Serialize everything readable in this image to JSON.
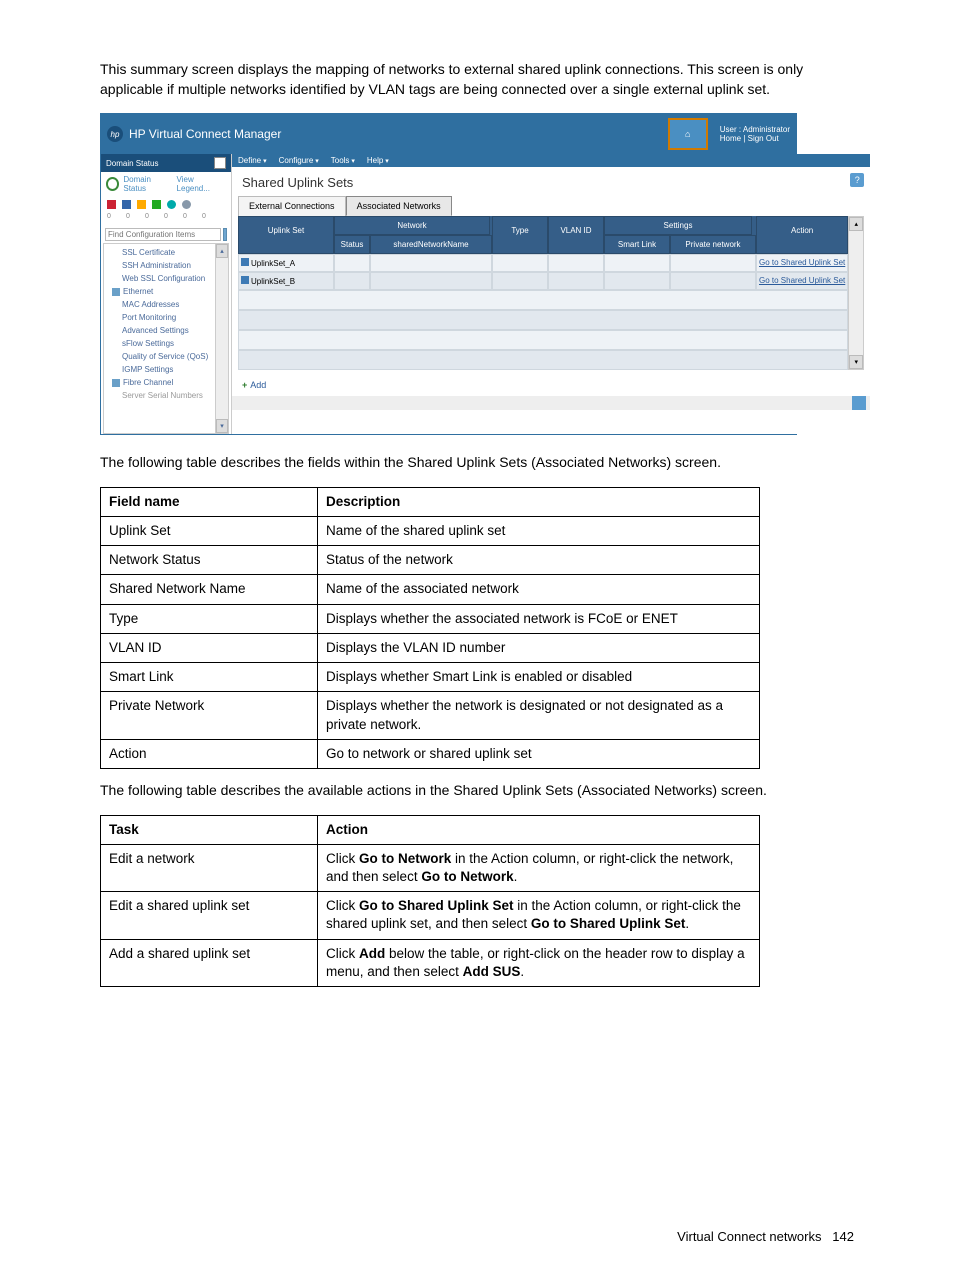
{
  "intro_paragraph": "This summary screen displays the mapping of networks to external shared uplink connections. This screen is only applicable if multiple networks identified by VLAN tags are being connected over a single external uplink set.",
  "table1_intro": "The following table describes the fields within the Shared Uplink Sets (Associated Networks) screen.",
  "table2_intro": "The following table describes the available actions in the Shared Uplink Sets (Associated Networks) screen.",
  "footer": {
    "section": "Virtual Connect networks",
    "page": "142"
  },
  "app": {
    "title": "HP Virtual Connect Manager",
    "user_line1": "User : Administrator",
    "user_line2": "Home  |  Sign Out",
    "menus": {
      "define": "Define",
      "configure": "Configure",
      "tools": "Tools",
      "help": "Help"
    },
    "domain_status_label": "Domain Status",
    "domain_status_link": "Domain Status",
    "view_legend": "View Legend...",
    "search_placeholder": "Find Configuration Items",
    "nav": {
      "ssl_cert": "SSL Certificate",
      "ssh_admin": "SSH Administration",
      "web_ssl": "Web SSL Configuration",
      "ethernet": "Ethernet",
      "mac": "MAC Addresses",
      "port_mon": "Port Monitoring",
      "adv": "Advanced Settings",
      "sflow": "sFlow Settings",
      "qos": "Quality of Service (QoS)",
      "igmp": "IGMP Settings",
      "fc": "Fibre Channel",
      "serial": "Server Serial Numbers"
    },
    "panel_title": "Shared Uplink Sets",
    "tabs": {
      "ext": "External Connections",
      "assoc": "Associated Networks"
    },
    "grid": {
      "h_uplink": "Uplink Set",
      "h_network_group": "Network",
      "h_status": "Status",
      "h_snn": "sharedNetworkName",
      "h_type": "Type",
      "h_vlan": "VLAN ID",
      "h_settings_group": "Settings",
      "h_smartlink": "Smart Link",
      "h_private": "Private network",
      "h_action": "Action",
      "row_a": "UplinkSet_A",
      "row_b": "UplinkSet_B",
      "action_link": "Go to Shared Uplink Set"
    },
    "add_label": "Add"
  },
  "fields_table": {
    "h1": "Field name",
    "h2": "Description",
    "rows": [
      {
        "name": "Uplink Set",
        "desc": "Name of the shared uplink set"
      },
      {
        "name": "Network Status",
        "desc": "Status of the network"
      },
      {
        "name": "Shared Network Name",
        "desc": "Name of the associated network"
      },
      {
        "name": "Type",
        "desc": "Displays whether the associated network is FCoE or ENET"
      },
      {
        "name": "VLAN ID",
        "desc": "Displays the VLAN ID number"
      },
      {
        "name": "Smart Link",
        "desc": "Displays whether Smart Link is enabled or disabled"
      },
      {
        "name": "Private Network",
        "desc": "Displays whether the network is designated or not designated as a private network."
      },
      {
        "name": "Action",
        "desc": "Go to network or shared uplink set"
      }
    ]
  },
  "actions_table": {
    "h1": "Task",
    "h2": "Action",
    "rows": [
      {
        "task": "Edit a network",
        "pre": "Click ",
        "b1": "Go to Network",
        "mid": " in the Action column, or right-click the network, and then select ",
        "b2": "Go to Network",
        "post": "."
      },
      {
        "task": "Edit a shared uplink set",
        "pre": "Click ",
        "b1": "Go to Shared Uplink Set",
        "mid": " in the Action column, or right-click the shared uplink set, and then select ",
        "b2": "Go to Shared Uplink Set",
        "post": "."
      },
      {
        "task": "Add a shared uplink set",
        "pre": "Click ",
        "b1": "Add",
        "mid": " below the table, or right-click on the header row to display a menu, and then select ",
        "b2": "Add SUS",
        "post": "."
      }
    ]
  }
}
